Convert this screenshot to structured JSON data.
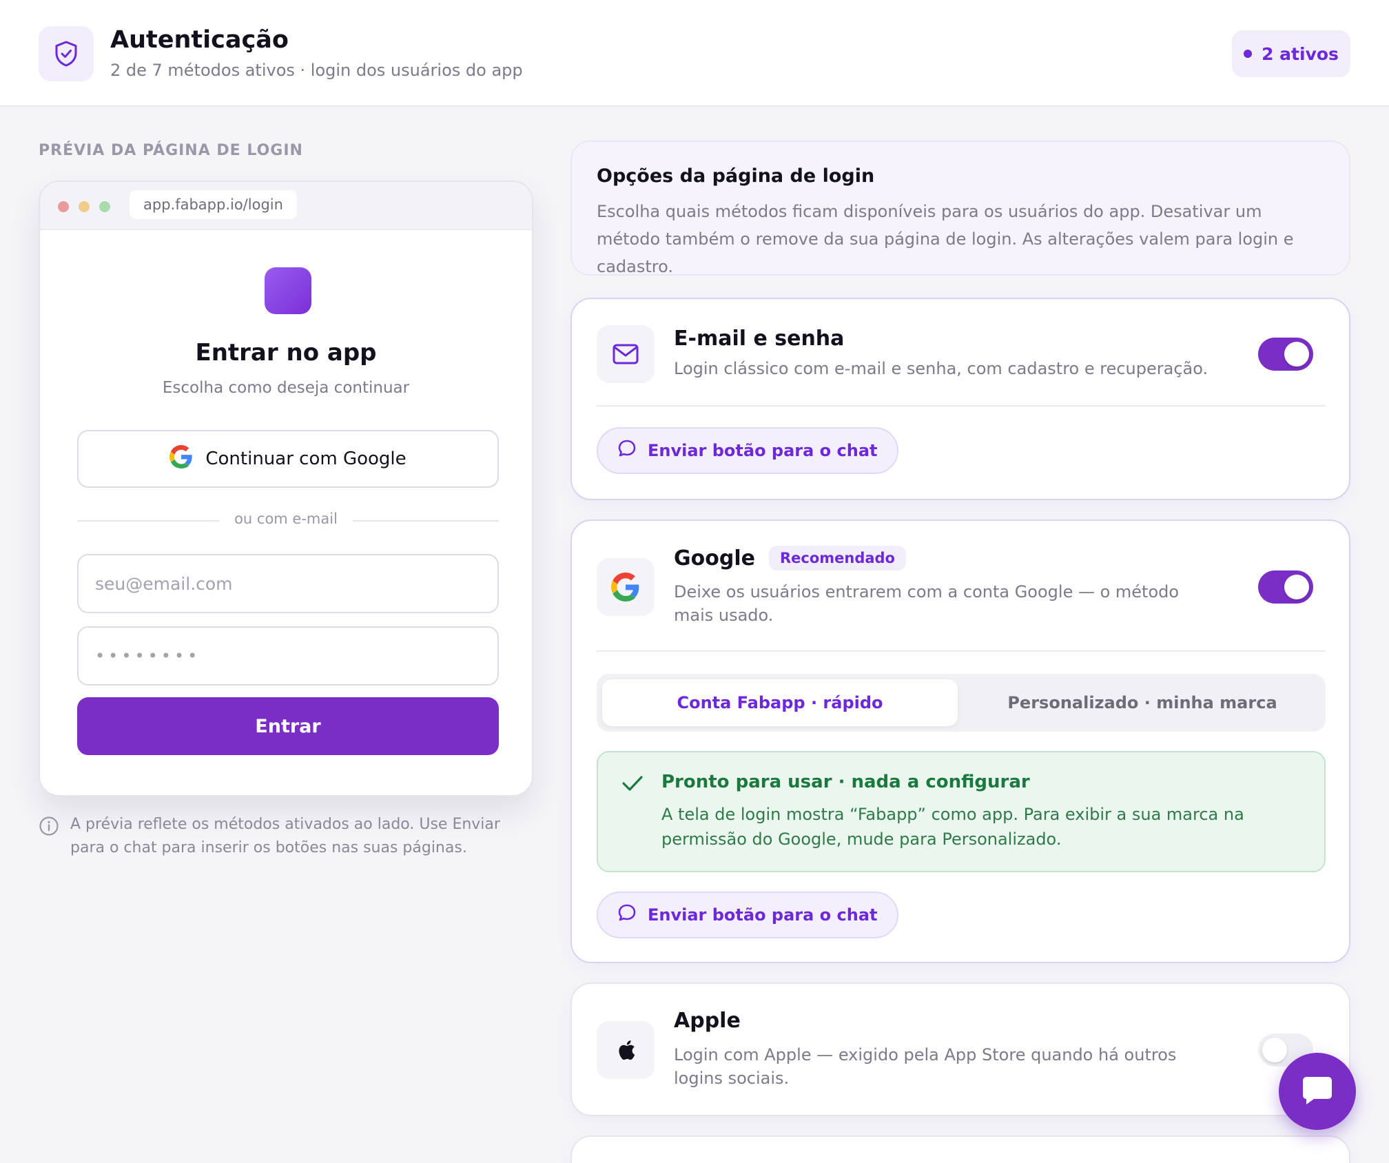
{
  "header": {
    "title": "Autenticação",
    "subtitle": "2 de 7 métodos ativos · login dos usuários do app",
    "active_badge": "2 ativos"
  },
  "preview": {
    "section_label": "PRÉVIA DA PÁGINA DE LOGIN",
    "url": "app.fabapp.io/login",
    "title": "Entrar no app",
    "subtitle": "Escolha como deseja continuar",
    "google_button": "Continuar com Google",
    "divider": "ou com e-mail",
    "email_placeholder": "seu@email.com",
    "password_mask": "••••••••",
    "submit": "Entrar",
    "note": "A prévia reflete os métodos ativados ao lado. Use Enviar para o chat para inserir os botões nas suas páginas."
  },
  "options": {
    "title": "Opções da página de login",
    "description": "Escolha quais métodos ficam disponíveis para os usuários do app. Desativar um método também o remove da sua página de login. As alterações valem para login e cadastro."
  },
  "methods": {
    "email": {
      "title": "E-mail e senha",
      "description": "Login clássico com e-mail e senha, com cadastro e recuperação.",
      "enabled": true,
      "chat_button": "Enviar botão para o chat"
    },
    "google": {
      "title": "Google",
      "badge": "Recomendado",
      "description": "Deixe os usuários entrarem com a conta Google — o método mais usado.",
      "enabled": true,
      "tabs": [
        "Conta Fabapp · rápido",
        "Personalizado · minha marca"
      ],
      "selected_tab": "Conta Fabapp · rápido",
      "ready_title": "Pronto para usar · nada a configurar",
      "ready_description": "A tela de login mostra “Fabapp” como app. Para exibir a sua marca na permissão do Google, mude para Personalizado.",
      "chat_button": "Enviar botão para o chat"
    },
    "apple": {
      "title": "Apple",
      "description": "Login com Apple — exigido pela App Store quando há outros logins sociais.",
      "enabled": false
    }
  },
  "colors": {
    "accent": "#7a2ec6",
    "accent_text": "#6d28d9",
    "success": "#1a7a3e",
    "background": "#f5f5f8"
  },
  "icons": [
    "shield-check-icon",
    "mail-icon",
    "google-icon",
    "apple-icon",
    "chat-bubble-icon",
    "info-icon",
    "check-icon"
  ]
}
